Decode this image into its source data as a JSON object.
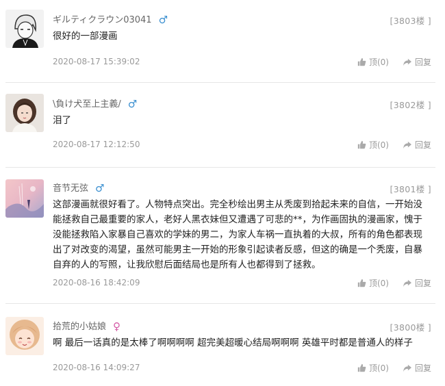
{
  "comments": [
    {
      "username": "ギルティクラウン03041",
      "gender_icon": "male-icon",
      "gender_symbol": "♂",
      "gender_color": "#3a8fd0",
      "floor": "[3803楼 ]",
      "text": "很好的一部漫画",
      "time": "2020-08-17 15:39:02",
      "like_label": "顶(0)",
      "reply_label": "回复"
    },
    {
      "username": "\\負け犬至上主義/",
      "gender_icon": "male-icon",
      "gender_symbol": "♂",
      "gender_color": "#3a8fd0",
      "floor": "[3802楼 ]",
      "text": "泪了",
      "time": "2020-08-17 12:12:50",
      "like_label": "顶(0)",
      "reply_label": "回复"
    },
    {
      "username": "音节无弦",
      "gender_icon": "male-icon",
      "gender_symbol": "♂",
      "gender_color": "#3a8fd0",
      "floor": "[3801楼 ]",
      "text": "这部漫画就很好看了。人物特点突出。完全秒绘出男主从秃废到拾起未来的自信，一开始没能拯救自己最重要的家人，老好人黑衣妹但又遭遇了可悲的**，为作画固执的漫画家，愧于没能拯救陷入家暴自己喜欢的学妹的男二，为家人车祸一直执着的大叔，所有的角色都表现出了对改变的渴望，虽然可能男主一开始的形象引起读者反感，但这的确是一个秃废，自暴自弃的人的写照，让我欣慰后面结局也是所有人也都得到了拯救。",
      "time": "2020-08-16 18:42:09",
      "like_label": "顶(0)",
      "reply_label": "回复"
    },
    {
      "username": "拾荒的小姑娘",
      "gender_icon": "female-icon",
      "gender_symbol": "♀",
      "gender_color": "#d45aa6",
      "floor": "[3800楼 ]",
      "text": "啊 最后一话真的是太棒了啊啊啊啊 超完美超暖心结局啊啊啊 英雄平时都是普通人的样子",
      "time": "2020-08-16 14:09:27",
      "like_label": "顶(0)",
      "reply_label": "回复"
    }
  ]
}
